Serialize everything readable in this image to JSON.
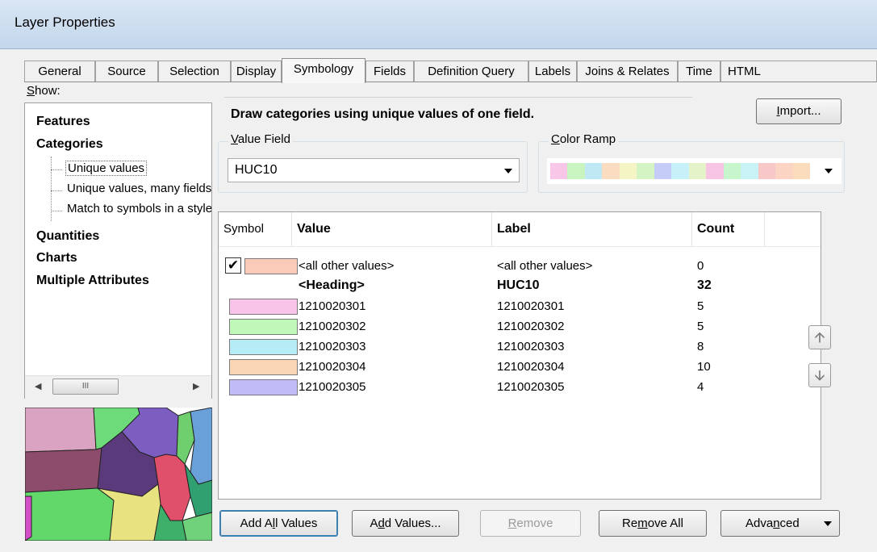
{
  "window": {
    "title": "Layer Properties"
  },
  "tabs": [
    "General",
    "Source",
    "Selection",
    "Display",
    "Symbology",
    "Fields",
    "Definition Query",
    "Labels",
    "Joins & Relates",
    "Time",
    "HTML"
  ],
  "active_tab": "Symbology",
  "show": {
    "label_u": "S",
    "label_rest": "how:",
    "items": {
      "features": "Features",
      "categories": "Categories",
      "unique_values": "Unique values",
      "unique_values_many": "Unique values, many fields",
      "match_symbols": "Match to symbols in a style",
      "quantities": "Quantities",
      "charts": "Charts",
      "multiple_attributes": "Multiple Attributes"
    },
    "scroll_thumb": "III"
  },
  "main": {
    "description": "Draw categories using unique values of one field.",
    "import_u": "I",
    "import_rest": "mport...",
    "value_field": {
      "label_u": "V",
      "label_rest": "alue Field",
      "value": "HUC10"
    },
    "color_ramp": {
      "label_u": "C",
      "label_rest": "olor Ramp",
      "colors": [
        "#f8c6e6",
        "#c8f4c0",
        "#c0e8f4",
        "#fadcc0",
        "#f4f4c4",
        "#d4f4c4",
        "#c6ccf8",
        "#c8f0f8",
        "#e4f4c8",
        "#f8c4e4",
        "#c8f6cc",
        "#c8f2f6",
        "#f8c8c8",
        "#fcd4c4",
        "#fadcbc"
      ]
    }
  },
  "table": {
    "headers": {
      "symbol": "Symbol",
      "value": "Value",
      "label": "Label",
      "count": "Count"
    },
    "rows": [
      {
        "checked": true,
        "color": "#f9cbb8",
        "value": "<all other values>",
        "label": "<all other values>",
        "count": "0",
        "bold": false
      },
      {
        "heading": true,
        "value": "<Heading>",
        "label": "HUC10",
        "count": "32",
        "bold": true
      },
      {
        "color": "#f8c4e8",
        "value": "1210020301",
        "label": "1210020301",
        "count": "5"
      },
      {
        "color": "#bff8b8",
        "value": "1210020302",
        "label": "1210020302",
        "count": "5"
      },
      {
        "color": "#b6ecf6",
        "value": "1210020303",
        "label": "1210020303",
        "count": "8"
      },
      {
        "color": "#fad5b4",
        "value": "1210020304",
        "label": "1210020304",
        "count": "10"
      },
      {
        "color": "#bfbcf7",
        "value": "1210020305",
        "label": "1210020305",
        "count": "4"
      }
    ]
  },
  "buttons": {
    "add_all": {
      "a": "Add A",
      "u": "l",
      "b": "l Values"
    },
    "add_values": {
      "a": "A",
      "u": "d",
      "b": "d Values..."
    },
    "remove": {
      "u": "R",
      "b": "emove"
    },
    "remove_all": {
      "a": "Re",
      "u": "m",
      "b": "ove All"
    },
    "advanced": {
      "a": "Adva",
      "u": "n",
      "b": "ced"
    }
  }
}
